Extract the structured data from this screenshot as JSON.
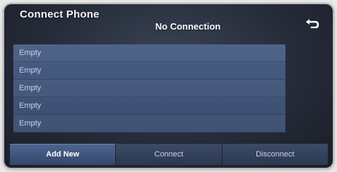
{
  "header": {
    "title": "Connect Phone",
    "status": "No Connection",
    "back_icon": "back-arrow-icon"
  },
  "devices": [
    {
      "label": "Empty"
    },
    {
      "label": "Empty"
    },
    {
      "label": "Empty"
    },
    {
      "label": "Empty"
    },
    {
      "label": "Empty"
    }
  ],
  "actions": {
    "add_new": "Add New",
    "connect": "Connect",
    "disconnect": "Disconnect"
  },
  "colors": {
    "background": "#252b38",
    "list": "#44587d",
    "active_button": "#4f6590"
  }
}
